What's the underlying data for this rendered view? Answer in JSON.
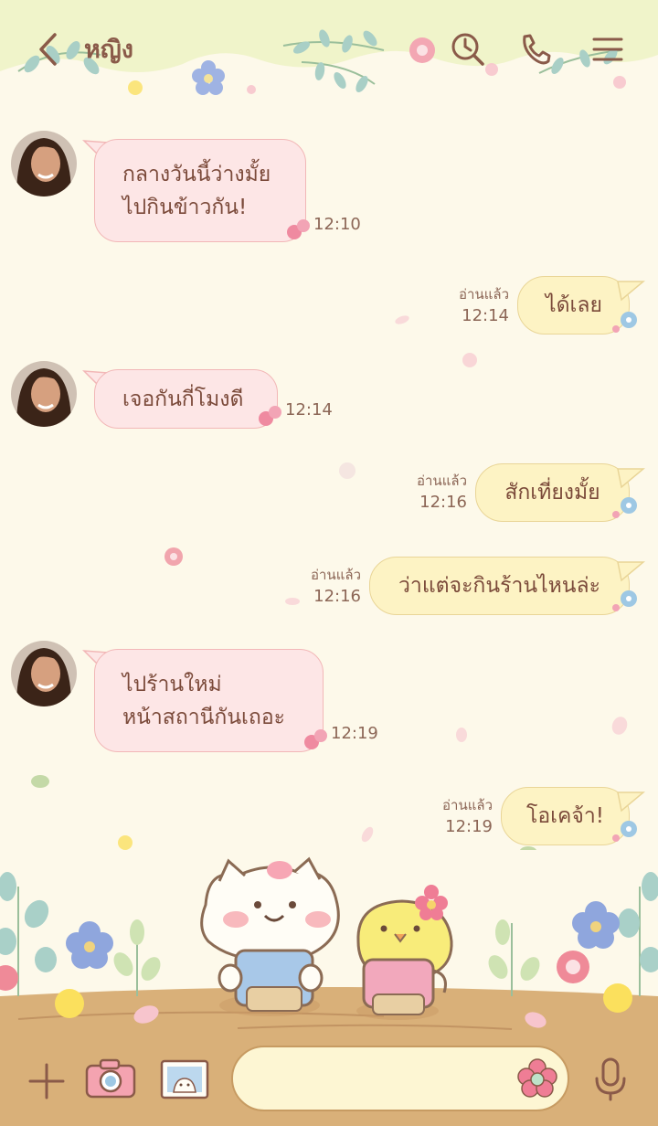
{
  "header": {
    "back_icon": "chevron-left-icon",
    "title": "หญิง",
    "actions": [
      "clock-icon",
      "phone-icon",
      "menu-icon"
    ]
  },
  "messages": [
    {
      "side": "in",
      "lines": [
        "กลางวันนี้ว่างมั้ย",
        "ไปกินข้าวกัน!"
      ],
      "time": "12:10"
    },
    {
      "side": "out",
      "lines": [
        "ได้เลย"
      ],
      "read": "อ่านแล้ว",
      "time": "12:14"
    },
    {
      "side": "in",
      "lines": [
        "เจอกันกี่โมงดี"
      ],
      "time": "12:14"
    },
    {
      "side": "out",
      "lines": [
        "สักเที่ยงมั้ย"
      ],
      "read": "อ่านแล้ว",
      "time": "12:16"
    },
    {
      "side": "out",
      "lines": [
        "ว่าแต่จะกินร้านไหนล่ะ"
      ],
      "read": "อ่านแล้ว",
      "time": "12:16"
    },
    {
      "side": "in",
      "lines": [
        "ไปร้านใหม่",
        "หน้าสถานีกันเถอะ"
      ],
      "time": "12:19"
    },
    {
      "side": "out",
      "lines": [
        "โอเคจ้า!"
      ],
      "read": "อ่านแล้ว",
      "time": "12:19"
    }
  ],
  "composer": {
    "input_value": "",
    "icons": [
      "plus-icon",
      "camera-icon",
      "image-icon",
      "flower-sticker-icon",
      "microphone-icon"
    ]
  },
  "colors": {
    "background": "#fdf9ea",
    "incoming_bubble": "#fde6e6",
    "outgoing_bubble": "#fdf3c4",
    "text": "#7b4a3a",
    "toolbar": "#d9b079"
  }
}
